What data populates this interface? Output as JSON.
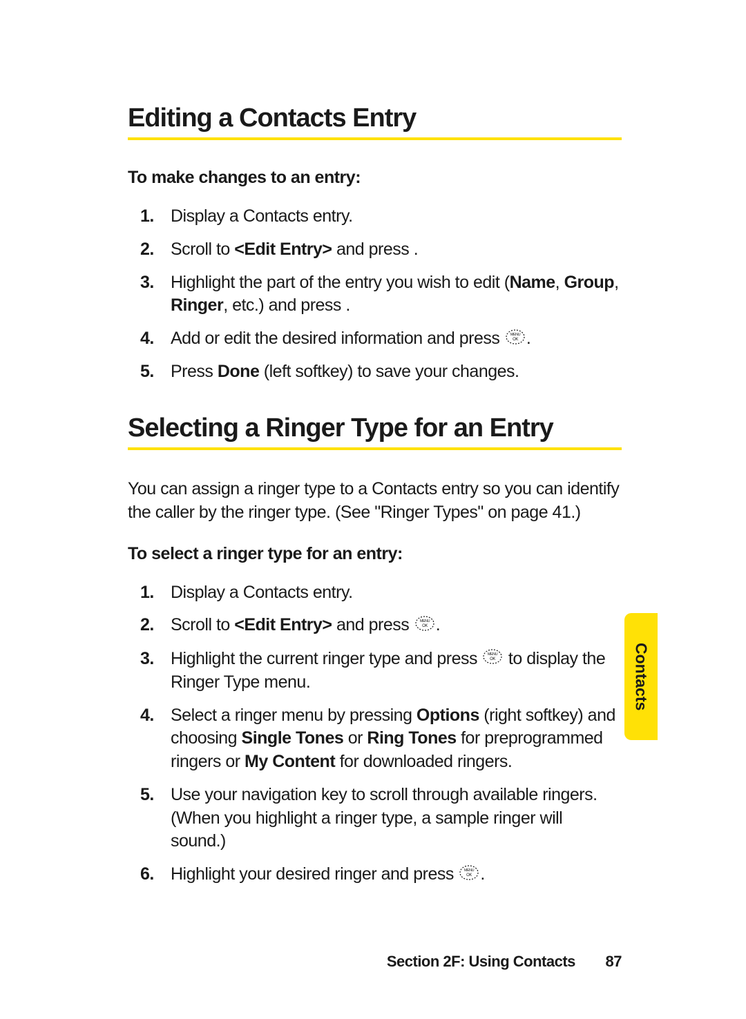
{
  "section1": {
    "heading": "Editing a Contacts Entry",
    "subheading": "To make changes to an entry:",
    "steps": [
      {
        "num": "1.",
        "text": "Display a Contacts entry."
      },
      {
        "num": "2.",
        "pre": "Scroll to ",
        "bold1": "<Edit Entry>",
        "mid": " and press ",
        "after": "."
      },
      {
        "num": "3.",
        "pre": "Highlight the part of the entry you wish to edit (",
        "bold1": "Name",
        "mid": ", ",
        "bold2": "Group",
        "mid2": ", ",
        "bold3": "Ringer",
        "after": ", etc.) and press ",
        "tail": "."
      },
      {
        "num": "4.",
        "pre": "Add or edit the desired information and press ",
        "icon": true,
        "after": "."
      },
      {
        "num": "5.",
        "pre": "Press ",
        "bold1": "Done",
        "after": " (left softkey) to save your changes."
      }
    ]
  },
  "section2": {
    "heading": "Selecting a Ringer Type for an Entry",
    "intro": "You can assign a ringer type to a Contacts entry so you can identify the caller by the ringer type. (See \"Ringer Types\" on page 41.)",
    "subheading": "To select a ringer type for an entry:",
    "steps": [
      {
        "num": "1.",
        "text": "Display a Contacts entry."
      },
      {
        "num": "2.",
        "pre": "Scroll to ",
        "bold1": "<Edit Entry>",
        "mid": " and press ",
        "icon": true,
        "after": "."
      },
      {
        "num": "3.",
        "pre": "Highlight the current ringer type and press ",
        "icon": true,
        "after": " to display the Ringer Type menu."
      },
      {
        "num": "4.",
        "pre": "Select a ringer menu by pressing ",
        "bold1": "Options",
        "mid": " (right softkey) and choosing ",
        "bold2": "Single Tones",
        "mid2": " or ",
        "bold3": "Ring Tones",
        "mid3": " for preprogrammed ringers or ",
        "bold4": "My Content",
        "after": " for downloaded ringers."
      },
      {
        "num": "5.",
        "text": "Use your navigation key to scroll through available ringers. (When you highlight a ringer type, a sample ringer will sound.)"
      },
      {
        "num": "6.",
        "pre": "Highlight your desired ringer and press ",
        "icon": true,
        "after": "."
      }
    ]
  },
  "footer": {
    "section_label": "Section 2F: Using Contacts",
    "page_number": "87"
  },
  "sidebar_tab": "Contacts",
  "icon_label": "MENU OK"
}
